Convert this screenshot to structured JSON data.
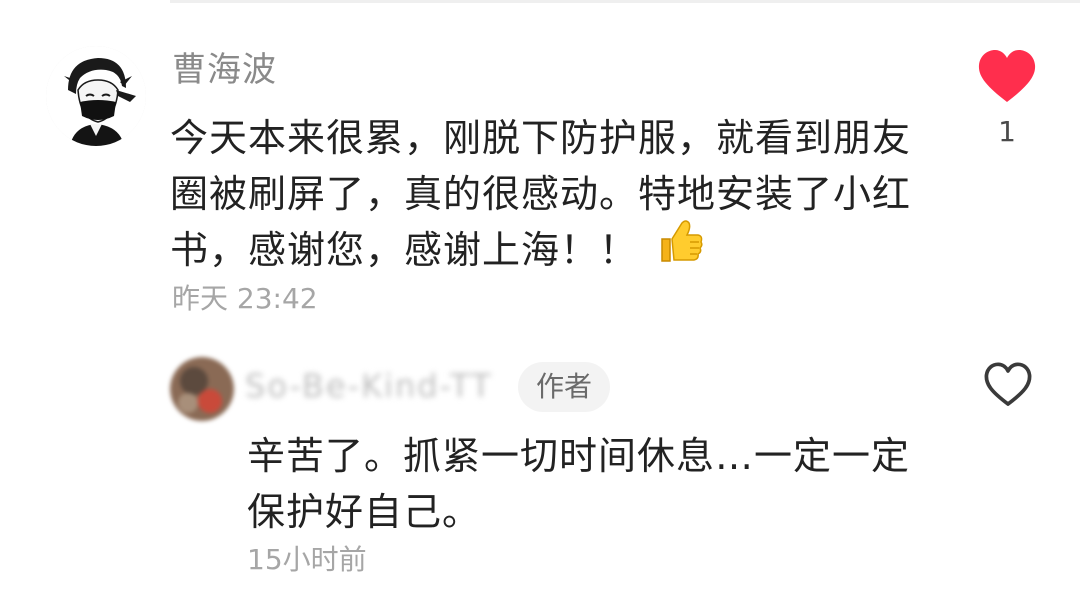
{
  "comment": {
    "author": "曹海波",
    "text": "今天本来很累，刚脱下防护服，就看到朋友圈被刷屏了，真的很感动。特地安装了小红书，感谢您，感谢上海！！",
    "emoji": "thumbs-up-emoji",
    "time": "昨天 23:42",
    "like_count": "1",
    "liked": true,
    "avatar_icon": "masked-person-avatar"
  },
  "reply": {
    "author": "So-Be-Kind-TT",
    "badge": "作者",
    "text": "辛苦了。抓紧一切时间休息…一定一定保护好自己。",
    "time": "15小时前",
    "liked": false,
    "avatar_icon": "blurred-avatar"
  },
  "colors": {
    "like_active": "#ff2e4d",
    "like_inactive": "#3a3a3a",
    "secondary_text": "#8a8a8a",
    "timestamp": "#a6a6a6",
    "badge_bg": "#f3f3f3"
  }
}
